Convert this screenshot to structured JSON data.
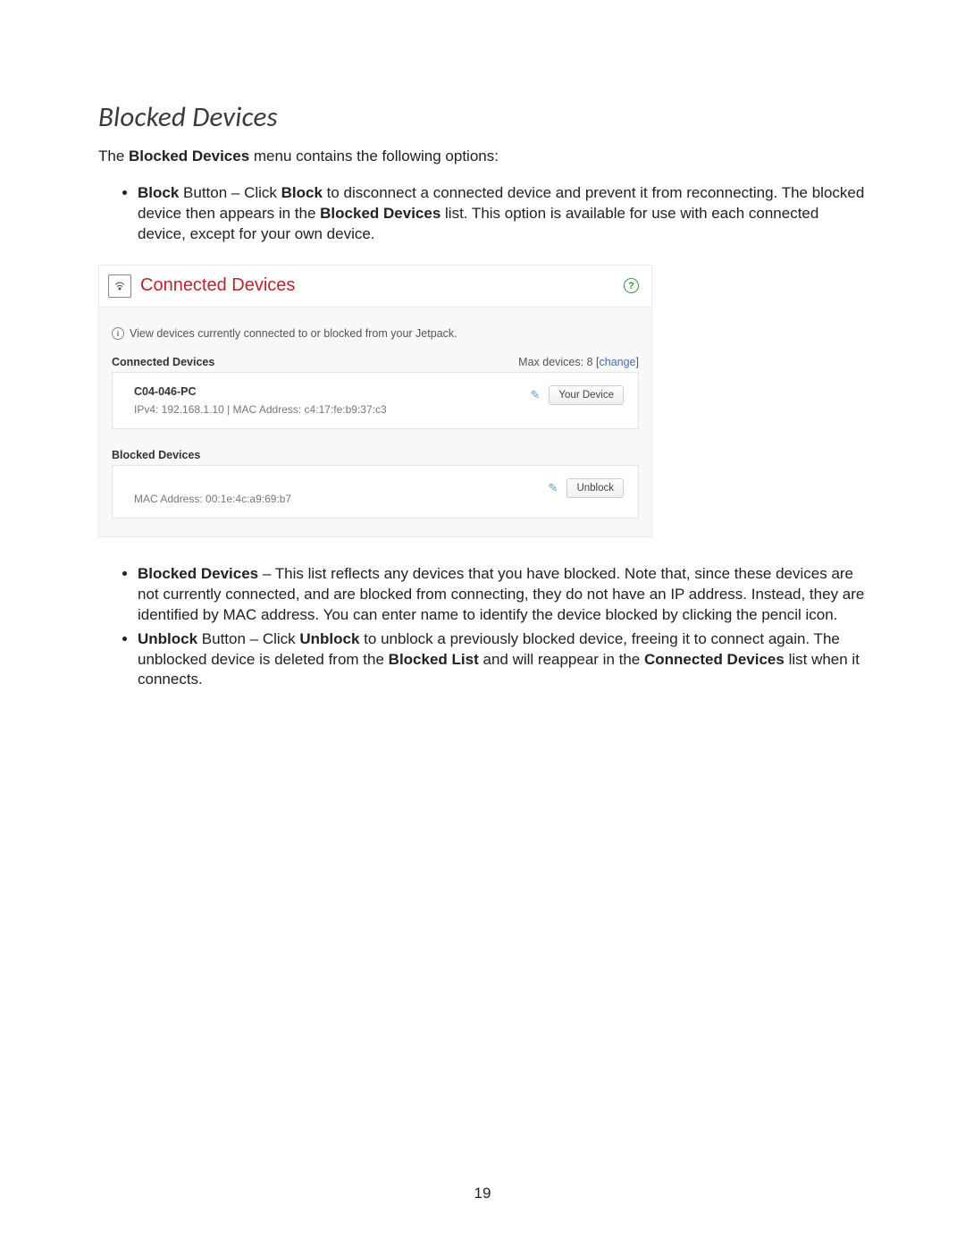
{
  "heading": "Blocked Devices",
  "intro_pre": "The ",
  "intro_bold": "Blocked Devices",
  "intro_post": " menu contains the following options:",
  "bullets_top": [
    {
      "segments": [
        {
          "b": true,
          "t": "Block"
        },
        {
          "b": false,
          "t": " Button – Click "
        },
        {
          "b": true,
          "t": "Block"
        },
        {
          "b": false,
          "t": " to disconnect a connected device and prevent it from reconnecting. The blocked device then appears in the "
        },
        {
          "b": true,
          "t": "Blocked Devices"
        },
        {
          "b": false,
          "t": " list. This option is available for use with each connected device, except for your own device."
        }
      ]
    }
  ],
  "panel": {
    "title": "Connected Devices",
    "info_text": "View devices currently connected to or blocked from your Jetpack.",
    "connected_hd": "Connected Devices",
    "max_prefix": "Max devices: ",
    "max_value": "8",
    "change_text": "change",
    "connected_device": {
      "name": "C04-046-PC",
      "details": "IPv4: 192.168.1.10 | MAC Address: c4:17:fe:b9:37:c3",
      "badge": "Your Device"
    },
    "blocked_hd": "Blocked Devices",
    "blocked_device": {
      "details": "MAC Address: 00:1e:4c:a9:69:b7",
      "button": "Unblock"
    }
  },
  "bullets_bottom": [
    {
      "segments": [
        {
          "b": true,
          "t": "Blocked Devices"
        },
        {
          "b": false,
          "t": " – This list reflects any devices that you have blocked. Note that, since these devices are not currently connected, and are blocked from connecting, they do not have an IP address. Instead, they are identified by MAC address. You can enter name to identify the device blocked by clicking the pencil icon."
        }
      ]
    },
    {
      "segments": [
        {
          "b": true,
          "t": "Unblock"
        },
        {
          "b": false,
          "t": " Button – Click "
        },
        {
          "b": true,
          "t": "Unblock"
        },
        {
          "b": false,
          "t": " to unblock a previously blocked device, freeing it to connect again. The unblocked device is deleted from the "
        },
        {
          "b": true,
          "t": "Blocked List"
        },
        {
          "b": false,
          "t": " and will reappear in the "
        },
        {
          "b": true,
          "t": "Connected Devices"
        },
        {
          "b": false,
          "t": " list when it connects."
        }
      ]
    }
  ],
  "page_number": "19"
}
